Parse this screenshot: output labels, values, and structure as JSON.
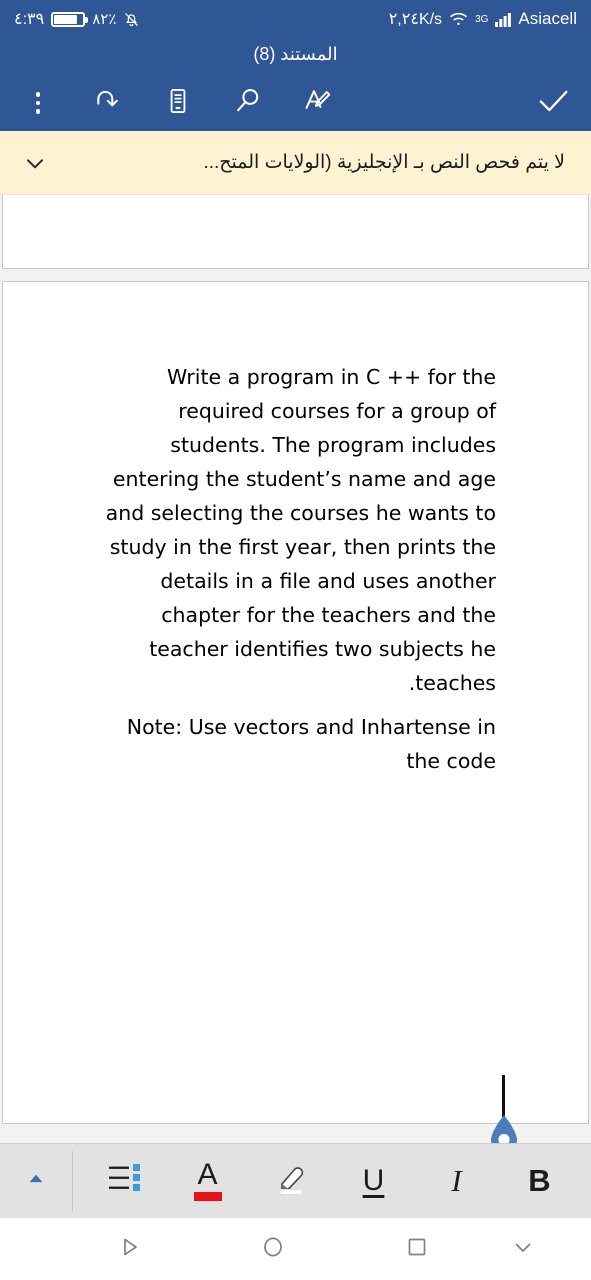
{
  "statusbar": {
    "time": "٤:٣٩",
    "battery_percent": "٨٢٪",
    "mute_icon": "bell-muted-icon",
    "network_speed": "٢,٢٤K/s",
    "wifi_icon": "wifi-icon",
    "network_type": "3G",
    "signal_icon": "signal-bars-icon",
    "carrier": "Asiacell",
    "background_color": "#2f5695"
  },
  "header": {
    "title": "المستند (8)",
    "accent_color": "#2f5695"
  },
  "toolbar": {
    "overflow_label": "more-options",
    "redo_label": "redo",
    "mobile_view_label": "mobile-view",
    "search_label": "search",
    "edit_label": "edit-text",
    "done_label": "done"
  },
  "notice": {
    "text": "لا يتم فحص النص بـ الإنجليزية (الولايات المتح...",
    "expand_icon": "chevron-down-icon",
    "background_color": "#fdf3d2"
  },
  "document": {
    "paragraphs": [
      "Write a program in C ++ for the required courses for a group of students. The program includes entering the student’s name and age and selecting the courses he wants to study in the first year, then prints the details in a file and uses another chapter for the teachers and the teacher identifies two subjects he .teaches",
      "Note: Use vectors and Inhartense in the code"
    ],
    "cursor_handle_color": "#4a7ebb"
  },
  "formatbar": {
    "collapse_icon": "chevron-up-icon",
    "items": [
      {
        "name": "bullet-list",
        "label": "",
        "icon": "bullet-list-rtl-icon"
      },
      {
        "name": "font-color",
        "label": "A",
        "icon": "font-color-icon",
        "swatch_color": "#e81313"
      },
      {
        "name": "highlight",
        "label": "",
        "icon": "highlighter-icon"
      },
      {
        "name": "underline",
        "label": "U",
        "icon": "underline-icon"
      },
      {
        "name": "italic",
        "label": "I",
        "icon": "italic-icon"
      },
      {
        "name": "bold",
        "label": "B",
        "icon": "bold-icon"
      }
    ],
    "background_color": "#e2e2e2"
  },
  "navbar": {
    "back_icon": "triangle-back-icon",
    "home_icon": "circle-home-icon",
    "recents_icon": "square-recents-icon",
    "dismiss_keyboard_icon": "chevron-down-icon"
  }
}
